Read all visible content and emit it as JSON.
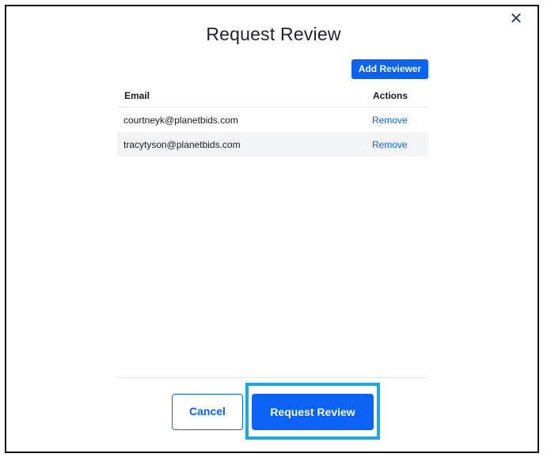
{
  "dialog": {
    "title": "Request Review",
    "close_icon": "close-icon",
    "close_glyph": "✕"
  },
  "toolbar": {
    "add_reviewer_label": "Add Reviewer"
  },
  "table": {
    "headers": [
      "Email",
      "Actions"
    ],
    "rows": [
      {
        "email": "courtneyk@planetbids.com",
        "action": "Remove"
      },
      {
        "email": "tracytyson@planetbids.com",
        "action": "Remove"
      }
    ]
  },
  "footer": {
    "cancel_label": "Cancel",
    "request_review_label": "Request Review"
  },
  "colors": {
    "accent": "#0a63f4",
    "highlight": "#1aaae2",
    "row_alt": "#f2f4f6"
  }
}
